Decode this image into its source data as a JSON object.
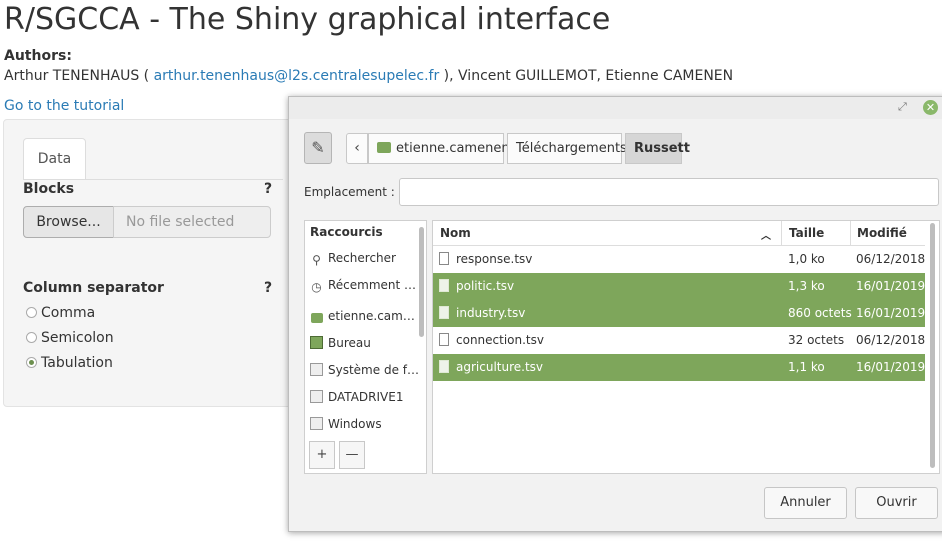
{
  "page": {
    "title": "R/SGCCA - The Shiny graphical interface",
    "authors_label": "Authors:",
    "authors_prefix": "Arthur TENENHAUS (",
    "author_email": "arthur.tenenhaus@l2s.centralesupelec.fr",
    "authors_suffix": "), Vincent GUILLEMOT, Etienne CAMENEN",
    "tutorial_link": "Go to the tutorial"
  },
  "sidebar": {
    "tab_data": "Data",
    "blocks_label": "Blocks",
    "help": "?",
    "browse_button": "Browse...",
    "file_placeholder": "No file selected",
    "separator_label": "Column separator",
    "separators": [
      {
        "label": "Comma",
        "selected": false
      },
      {
        "label": "Semicolon",
        "selected": false
      },
      {
        "label": "Tabulation",
        "selected": true
      }
    ]
  },
  "dialog": {
    "path": [
      "etienne.camenen",
      "Téléchargements",
      "Russett"
    ],
    "location_label": "Emplacement :",
    "location_value": "",
    "places_header": "Raccourcis",
    "places": [
      {
        "label": "Rechercher",
        "icon": "search-icon"
      },
      {
        "label": "Récemment …",
        "icon": "clock-icon"
      },
      {
        "label": "etienne.cam…",
        "icon": "home-folder-icon"
      },
      {
        "label": "Bureau",
        "icon": "desktop-icon"
      },
      {
        "label": "Système de f…",
        "icon": "drive-icon"
      },
      {
        "label": "DATADRIVE1",
        "icon": "drive-icon"
      },
      {
        "label": "Windows",
        "icon": "drive-icon"
      }
    ],
    "add_place": "+",
    "remove_place": "—",
    "columns": {
      "name": "Nom",
      "size": "Taille",
      "modified": "Modifié"
    },
    "files": [
      {
        "name": "response.tsv",
        "size": "1,0 ko",
        "modified": "06/12/2018",
        "selected": false
      },
      {
        "name": "politic.tsv",
        "size": "1,3 ko",
        "modified": "16/01/2019",
        "selected": true
      },
      {
        "name": "industry.tsv",
        "size": "860 octets",
        "modified": "16/01/2019",
        "selected": true
      },
      {
        "name": "connection.tsv",
        "size": "32 octets",
        "modified": "06/12/2018",
        "selected": false
      },
      {
        "name": "agriculture.tsv",
        "size": "1,1 ko",
        "modified": "16/01/2019",
        "selected": true
      }
    ],
    "cancel_button": "Annuler",
    "open_button": "Ouvrir",
    "accent_color": "#7ea65b"
  }
}
